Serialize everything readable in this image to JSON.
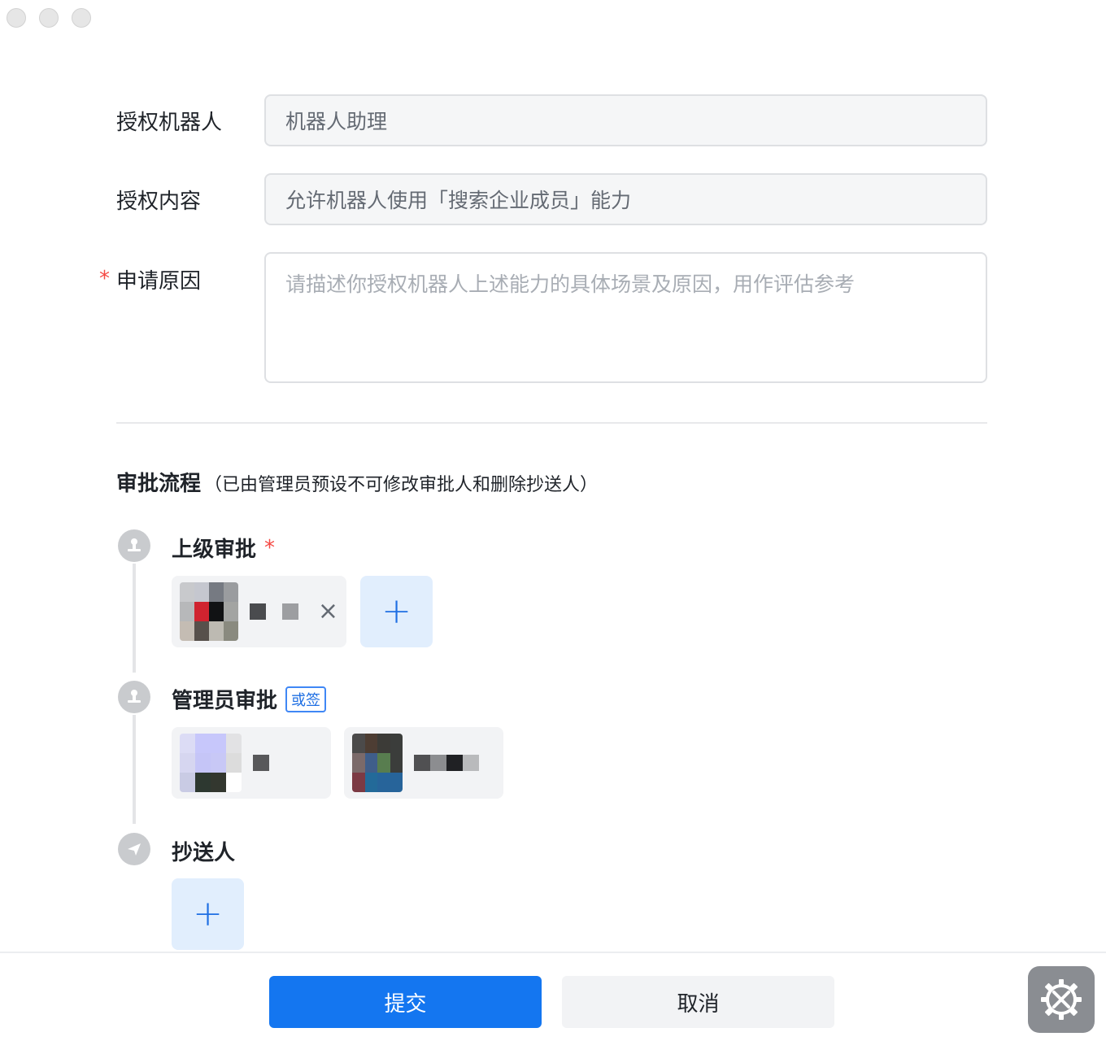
{
  "form": {
    "robot_label": "授权机器人",
    "robot_value": "机器人助理",
    "content_label": "授权内容",
    "content_value": "允许机器人使用「搜索企业成员」能力",
    "reason_required": "*",
    "reason_label": "申请原因",
    "reason_placeholder": "请描述你授权机器人上述能力的具体场景及原因，用作评估参考"
  },
  "approval": {
    "title": "审批流程",
    "note": "（已由管理员预设不可修改审批人和删除抄送人）",
    "nodes": [
      {
        "title": "上级审批",
        "required": "*",
        "add_symbol": "+",
        "remove_symbol": "×",
        "icon": "stamp-icon"
      },
      {
        "title": "管理员审批",
        "tag": "或签",
        "icon": "stamp-icon"
      },
      {
        "title": "抄送人",
        "add_symbol": "+",
        "icon": "send-icon"
      }
    ]
  },
  "footer": {
    "submit_label": "提交",
    "cancel_label": "取消",
    "gear_icon": "settings-tools-icon"
  },
  "colors": {
    "primary": "#1476f0",
    "required": "#f54a45",
    "add_bg": "#e1eefd"
  }
}
